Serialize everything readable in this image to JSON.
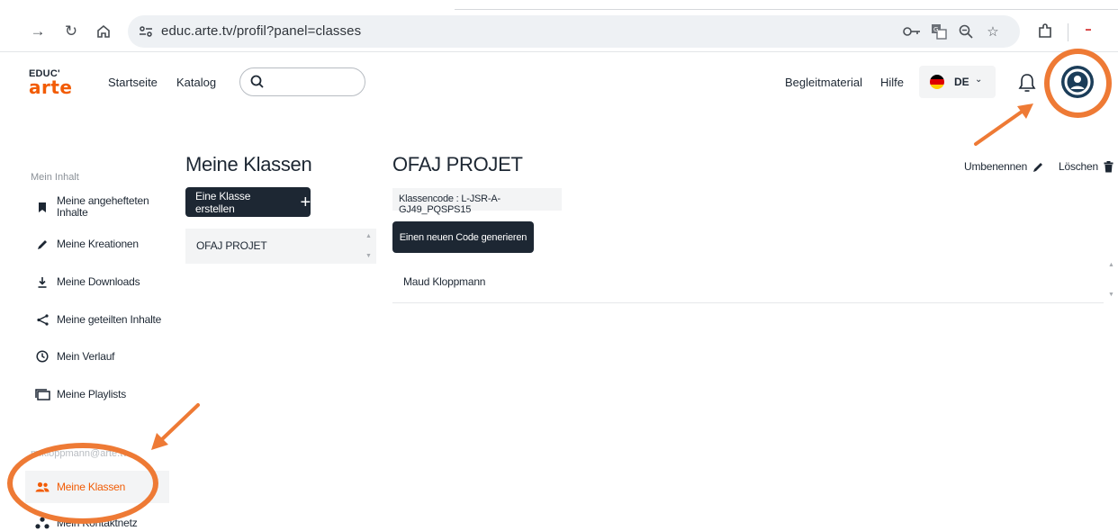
{
  "browser": {
    "url": "educ.arte.tv/profil?panel=classes",
    "back_icon": "arrow-right-icon",
    "reload_icon": "reload-icon",
    "home_icon": "home-icon"
  },
  "header": {
    "logo_top": "EDUC'",
    "logo_bottom": "arte",
    "nav": [
      "Startseite",
      "Katalog"
    ],
    "search_placeholder": "",
    "links": [
      "Begleitmaterial",
      "Hilfe"
    ],
    "language": "DE"
  },
  "sidebar": {
    "group_label": "Mein Inhalt",
    "items": [
      {
        "label": "Meine angehefteten Inhalte",
        "icon": "bookmark-icon"
      },
      {
        "label": "Meine Kreationen",
        "icon": "pencil-icon"
      },
      {
        "label": "Meine Downloads",
        "icon": "download-icon"
      },
      {
        "label": "Meine geteilten Inhalte",
        "icon": "share-icon"
      },
      {
        "label": "Mein Verlauf",
        "icon": "clock-icon"
      },
      {
        "label": "Meine Playlists",
        "icon": "playlist-icon"
      }
    ],
    "account_label": "m.kloppmann@arte.tv",
    "account_items": [
      {
        "label": "Meine Klassen",
        "icon": "users-icon",
        "active": true
      },
      {
        "label": "Mein Kontaktnetz",
        "icon": "network-icon"
      }
    ]
  },
  "classes": {
    "title": "Meine Klassen",
    "create_label": "Eine Klasse erstellen",
    "items": [
      "OFAJ PROJET"
    ]
  },
  "detail": {
    "title": "OFAJ PROJET",
    "rename_label": "Umbenennen",
    "delete_label": "Löschen",
    "code_text": "Klassencode : L-JSR-A-GJ49_PQSPS15",
    "generate_label": "Einen neuen Code generieren",
    "members": [
      "Maud Kloppmann"
    ]
  },
  "colors": {
    "accent": "#f25c05",
    "dark": "#1d2733",
    "annotation": "#ee7a35",
    "avatar": "#1b3d59"
  }
}
